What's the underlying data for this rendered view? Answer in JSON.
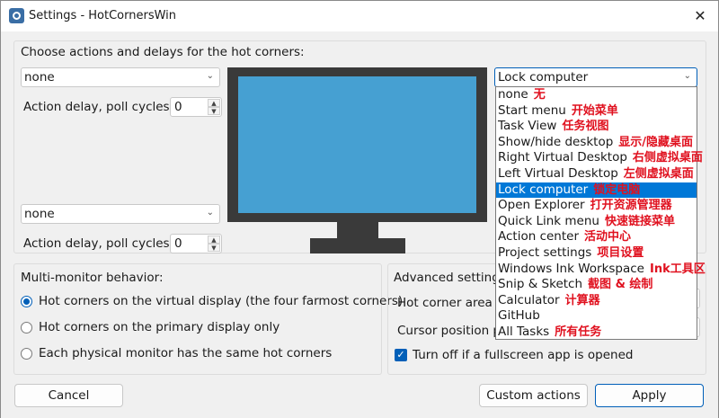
{
  "window": {
    "title": "Settings - HotCornersWin",
    "close_glyph": "✕"
  },
  "corners": {
    "heading": "Choose actions and delays for the hot corners:",
    "top_left": {
      "action": "none",
      "delay_label": "Action delay, poll cycles:",
      "delay_value": "0"
    },
    "bottom_left": {
      "action": "none",
      "delay_label": "Action delay, poll cycles:",
      "delay_value": "0"
    },
    "top_right": {
      "action": "Lock computer"
    }
  },
  "dropdown": {
    "selected_index": 6,
    "items": [
      {
        "en": "none",
        "zh": "无"
      },
      {
        "en": "Start menu",
        "zh": "开始菜单"
      },
      {
        "en": "Task View",
        "zh": "任务视图"
      },
      {
        "en": "Show/hide desktop",
        "zh": "显示/隐藏桌面"
      },
      {
        "en": "Right Virtual Desktop",
        "zh": "右侧虚拟桌面"
      },
      {
        "en": "Left Virtual Desktop",
        "zh": "左侧虚拟桌面"
      },
      {
        "en": "Lock computer",
        "zh": "锁定电脑"
      },
      {
        "en": "Open Explorer",
        "zh": "打开资源管理器"
      },
      {
        "en": "Quick Link menu",
        "zh": "快速链接菜单"
      },
      {
        "en": "Action center",
        "zh": "活动中心"
      },
      {
        "en": "Project settings",
        "zh": "项目设置"
      },
      {
        "en": "Windows Ink Workspace",
        "zh": "Ink工具区"
      },
      {
        "en": "Snip & Sketch",
        "zh": "截图 & 绘制"
      },
      {
        "en": "Calculator",
        "zh": "计算器"
      },
      {
        "en": "GitHub",
        "zh": ""
      },
      {
        "en": "All Tasks",
        "zh": "所有任务"
      }
    ]
  },
  "multimonitor": {
    "heading": "Multi-monitor behavior:",
    "options": [
      {
        "label": "Hot corners on the virtual display (the four farmost corners)",
        "checked": true
      },
      {
        "label": "Hot corners on the primary display only",
        "checked": false
      },
      {
        "label": "Each physical monitor has the same hot corners",
        "checked": false
      }
    ]
  },
  "advanced": {
    "heading": "Advanced settings",
    "hot_corner_area_label": "Hot corner area s",
    "cursor_position_label": "Cursor position p",
    "fullscreen_label": "Turn off if a fullscreen app is opened",
    "fullscreen_checked": true
  },
  "buttons": {
    "cancel": "Cancel",
    "custom_actions": "Custom actions",
    "apply": "Apply"
  },
  "colors": {
    "accent": "#005fb8",
    "selection": "#0078d7",
    "monitor_screen": "#46a0d2",
    "monitor_frame": "#3a3a3a",
    "annotation_red": "#e0111f"
  }
}
